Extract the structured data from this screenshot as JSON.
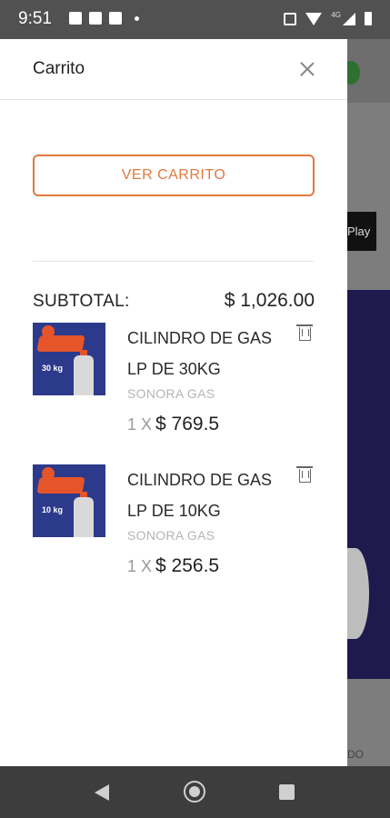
{
  "status_bar": {
    "time": "9:51",
    "network_label": "4G"
  },
  "background_page": {
    "play_label": "Play",
    "bottom_text": "DO"
  },
  "drawer": {
    "title": "Carrito",
    "view_cart_button": "VER CARRITO",
    "subtotal_label": "SUBTOTAL:",
    "subtotal_value": "$ 1,026.00",
    "items": [
      {
        "name": "CILINDRO DE GAS LP DE 30KG",
        "brand": "SONORA GAS",
        "quantity": "1 X",
        "price": "$ 769.5",
        "thumb_label": "30 kg"
      },
      {
        "name": "CILINDRO DE GAS LP DE 10KG",
        "brand": "SONORA GAS",
        "quantity": "1 X",
        "price": "$ 256.5",
        "thumb_label": "10 kg"
      }
    ]
  },
  "colors": {
    "accent": "#e07a3e",
    "thumb_bg": "#2c3a8c"
  }
}
